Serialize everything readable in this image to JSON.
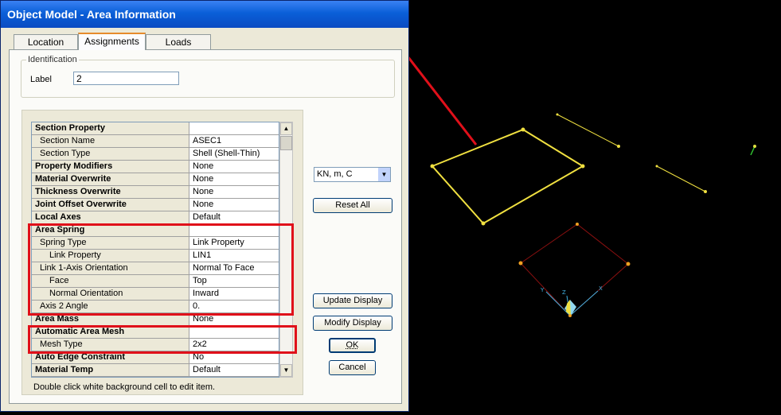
{
  "window": {
    "title": "Object Model - Area Information"
  },
  "tabs": [
    {
      "label": "Location"
    },
    {
      "label": "Assignments"
    },
    {
      "label": "Loads"
    }
  ],
  "identification": {
    "group_title": "Identification",
    "label_caption": "Label",
    "label_value": "2"
  },
  "properties": [
    {
      "name": "Section Property",
      "value": "",
      "bold": true,
      "indent": 0
    },
    {
      "name": "Section Name",
      "value": "ASEC1",
      "bold": false,
      "indent": 1
    },
    {
      "name": "Section Type",
      "value": "Shell (Shell-Thin)",
      "bold": false,
      "indent": 1
    },
    {
      "name": "Property Modifiers",
      "value": "None",
      "bold": true,
      "indent": 0
    },
    {
      "name": "Material Overwrite",
      "value": "None",
      "bold": true,
      "indent": 0
    },
    {
      "name": "Thickness Overwrite",
      "value": "None",
      "bold": true,
      "indent": 0
    },
    {
      "name": "Joint Offset Overwrite",
      "value": "None",
      "bold": true,
      "indent": 0
    },
    {
      "name": "Local Axes",
      "value": "Default",
      "bold": true,
      "indent": 0
    },
    {
      "name": "Area Spring",
      "value": "",
      "bold": true,
      "indent": 0
    },
    {
      "name": "Spring Type",
      "value": "Link Property",
      "bold": false,
      "indent": 1
    },
    {
      "name": "Link Property",
      "value": "LIN1",
      "bold": false,
      "indent": 2
    },
    {
      "name": "Link 1-Axis Orientation",
      "value": "Normal To Face",
      "bold": false,
      "indent": 1
    },
    {
      "name": "Face",
      "value": "Top",
      "bold": false,
      "indent": 2
    },
    {
      "name": "Normal Orientation",
      "value": "Inward",
      "bold": false,
      "indent": 2
    },
    {
      "name": "Axis 2 Angle",
      "value": "0.",
      "bold": false,
      "indent": 1
    },
    {
      "name": "Area Mass",
      "value": "None",
      "bold": true,
      "indent": 0
    },
    {
      "name": "Automatic Area Mesh",
      "value": "",
      "bold": true,
      "indent": 0
    },
    {
      "name": "Mesh Type",
      "value": "2x2",
      "bold": false,
      "indent": 1
    },
    {
      "name": "Auto Edge Constraint",
      "value": "No",
      "bold": true,
      "indent": 0
    },
    {
      "name": "Material Temp",
      "value": "Default",
      "bold": true,
      "indent": 0
    }
  ],
  "hint": "Double click white background cell to edit item.",
  "units": {
    "selected": "KN, m, C"
  },
  "buttons": {
    "reset_all": "Reset All",
    "update_display": "Update Display",
    "modify_display": "Modify Display",
    "ok": "OK",
    "cancel": "Cancel"
  },
  "colors": {
    "annotation_red": "#e0101a",
    "model_yellow": "#f0e040",
    "model_darkred": "#8b0000",
    "axis_cyan": "#40b0e0"
  },
  "model": {
    "axis_labels": [
      "Y",
      "Z",
      "X"
    ]
  }
}
